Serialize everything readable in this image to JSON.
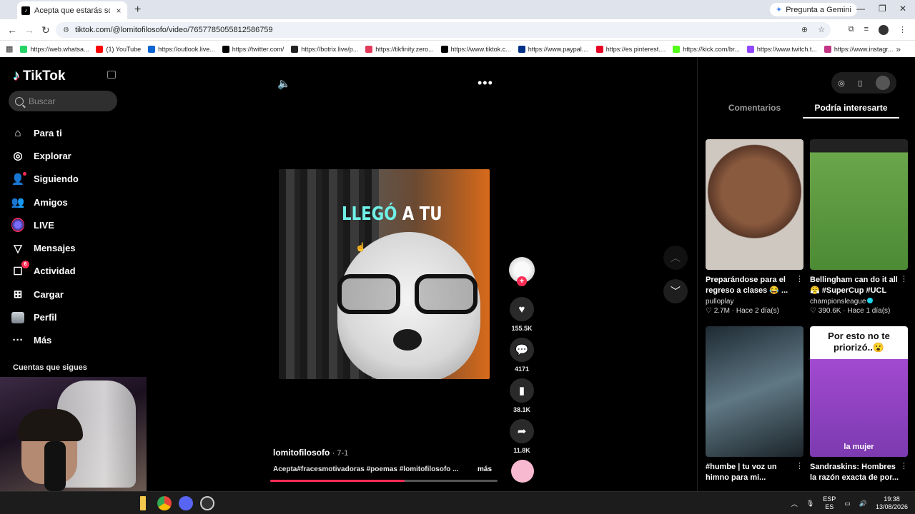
{
  "browser": {
    "tab_title": "Acepta que estarás solo toda la",
    "gemini_label": "Pregunta a Gemini",
    "url": "tiktok.com/@lomitofilosofo/video/7657785055812586759",
    "bookmarks": [
      {
        "label": "https://web.whatsa...",
        "color": "#25d366"
      },
      {
        "label": "(1) YouTube",
        "color": "#ff0000"
      },
      {
        "label": "https://outlook.live...",
        "color": "#0a64d2"
      },
      {
        "label": "https://twitter.com/",
        "color": "#000000"
      },
      {
        "label": "https://botrix.live/p...",
        "color": "#222222"
      },
      {
        "label": "https://tikfinity.zero...",
        "color": "#e23a5a"
      },
      {
        "label": "https://www.tiktok.c...",
        "color": "#000000"
      },
      {
        "label": "https://www.paypal....",
        "color": "#003087"
      },
      {
        "label": "https://es.pinterest....",
        "color": "#e60023"
      },
      {
        "label": "https://kick.com/br...",
        "color": "#53fc18"
      },
      {
        "label": "https://www.twitch.t...",
        "color": "#9146ff"
      },
      {
        "label": "https://www.instagr...",
        "color": "#c13584"
      }
    ]
  },
  "sidebar": {
    "brand": "TikTok",
    "search_placeholder": "Buscar",
    "items": [
      {
        "label": "Para ti",
        "icon": "home-icon"
      },
      {
        "label": "Explorar",
        "icon": "compass-icon"
      },
      {
        "label": "Siguiendo",
        "icon": "following-icon"
      },
      {
        "label": "Amigos",
        "icon": "friends-icon"
      },
      {
        "label": "LIVE",
        "icon": "live-icon"
      },
      {
        "label": "Mensajes",
        "icon": "messages-icon"
      },
      {
        "label": "Actividad",
        "icon": "activity-icon",
        "badge": "6"
      },
      {
        "label": "Cargar",
        "icon": "upload-icon"
      },
      {
        "label": "Perfil",
        "icon": "profile-icon"
      },
      {
        "label": "Más",
        "icon": "more-icon"
      }
    ],
    "following_heading": "Cuentas que sigues"
  },
  "video": {
    "overlay_caption_a": "LLEGÓ",
    "overlay_caption_b": "A TU",
    "author": "lomitofilosofo",
    "date": "· 7-1",
    "description": "Acepta#fracesmotivadoras #poemas #lomitofilosofo ...",
    "more": "más",
    "progress": 0.59,
    "likes": "155.5K",
    "comments": "4171",
    "saves": "38.1K",
    "shares": "11.8K"
  },
  "panel": {
    "tabs": [
      "Comentarios",
      "Podría interesarte"
    ],
    "active_tab": 1,
    "cards": [
      {
        "title": "Preparándose para el regreso a clases 😂 ...",
        "author": "pulloplay",
        "likes": "2.7M",
        "age": "Hace 2 día(s)",
        "verified": false
      },
      {
        "title": "Bellingham can do it all 😤 #SuperCup #UCL",
        "author": "championsleague",
        "likes": "390.6K",
        "age": "Hace 1 día(s)",
        "verified": true
      },
      {
        "title": "#humbe | tu voz un himno para mi...",
        "author": "",
        "likes": "",
        "age": "",
        "verified": false
      },
      {
        "title": "Sandraskins: Hombres la razón exacta de por...",
        "author": "",
        "likes": "",
        "age": "",
        "verified": false
      }
    ],
    "card4_overlay": "Por esto no te priorizó..😮",
    "card4_bottom": "la mujer"
  },
  "taskbar": {
    "lang_top": "ESP",
    "lang_bottom": "ES",
    "time": "19:38",
    "date": "13/08/2026"
  }
}
